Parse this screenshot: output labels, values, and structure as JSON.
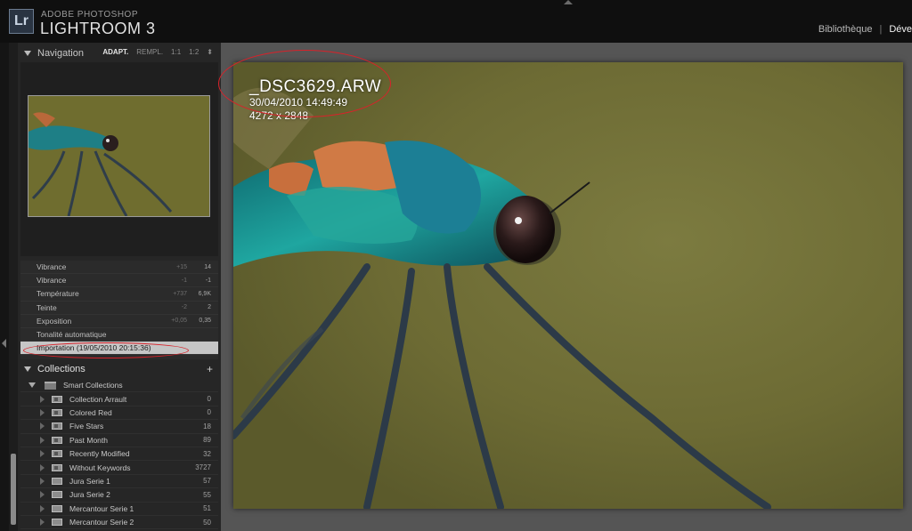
{
  "app": {
    "brand_sub": "ADOBE PHOTOSHOP",
    "brand_main": "LIGHTROOM 3",
    "logo_text": "Lr",
    "modules": [
      "Bibliothèque",
      "|",
      "Déve"
    ]
  },
  "navigator": {
    "title": "Navigation",
    "zoom_options": [
      "ADAPT.",
      "REMPL.",
      "1:1",
      "1:2"
    ],
    "zoom_extra_icon": "updown-arrows-icon"
  },
  "history": {
    "rows": [
      {
        "label": "Vibrance",
        "before": "+15",
        "after": "14"
      },
      {
        "label": "Vibrance",
        "before": "-1",
        "after": "-1"
      },
      {
        "label": "Température",
        "before": "+737",
        "after": "6,9K"
      },
      {
        "label": "Teinte",
        "before": "-2",
        "after": "2"
      },
      {
        "label": "Exposition",
        "before": "+0,05",
        "after": "0,35"
      },
      {
        "label": "Tonalité automatique",
        "before": "",
        "after": ""
      },
      {
        "label": "Importation (19/05/2010 20:15:36)",
        "before": "",
        "after": "",
        "selected": true
      }
    ]
  },
  "collections": {
    "title": "Collections",
    "add_icon": "plus-icon",
    "group": "Smart Collections",
    "items": [
      {
        "name": "Collection Arrault",
        "count": "0"
      },
      {
        "name": "Colored Red",
        "count": "0"
      },
      {
        "name": "Five Stars",
        "count": "18"
      },
      {
        "name": "Past Month",
        "count": "89"
      },
      {
        "name": "Recently Modified",
        "count": "32"
      },
      {
        "name": "Without Keywords",
        "count": "3727"
      },
      {
        "name": "Jura Serie 1",
        "count": "57"
      },
      {
        "name": "Jura Serie 2",
        "count": "55"
      },
      {
        "name": "Mercantour Serie 1",
        "count": "51"
      },
      {
        "name": "Mercantour Serie 2",
        "count": "50"
      }
    ]
  },
  "photo_info": {
    "filename": "_DSC3629.ARW",
    "datetime": "30/04/2010 14:49:49",
    "dimensions": "4272 x 2848"
  },
  "colors": {
    "annotation": "#d8222a",
    "photo_bg": "#6e6c35",
    "damselfly_body": "#1f8a8a"
  }
}
